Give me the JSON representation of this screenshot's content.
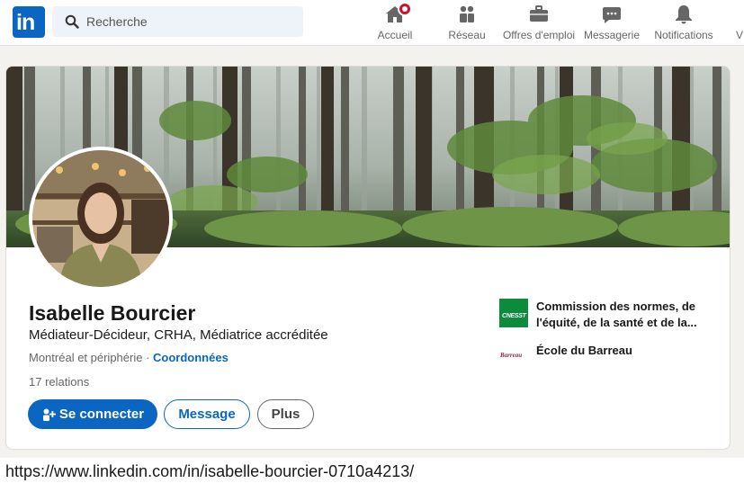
{
  "nav": {
    "search_placeholder": "Recherche",
    "items": [
      {
        "label": "Accueil",
        "icon": "home-icon"
      },
      {
        "label": "Réseau",
        "icon": "network-icon"
      },
      {
        "label": "Offres d'emploi",
        "icon": "briefcase-icon"
      },
      {
        "label": "Messagerie",
        "icon": "messaging-icon"
      },
      {
        "label": "Notifications",
        "icon": "bell-icon"
      },
      {
        "label": "V",
        "icon": "me-icon"
      }
    ],
    "brand_color": "#0a66c2"
  },
  "profile": {
    "name": "Isabelle Bourcier",
    "headline": "Médiateur-Décideur, CRHA, Médiatrice accréditée",
    "location": "Montréal et périphérie",
    "separator": " · ",
    "contact_link": "Coordonnées",
    "relations": "17 relations"
  },
  "actions": {
    "connect": "Se connecter",
    "message": "Message",
    "more": "Plus"
  },
  "experience": [
    {
      "logo_text": "CNESST",
      "label": "Commission des normes, de l'équité, de la santé et de la..."
    },
    {
      "logo_text": "Barreau",
      "label": "École du Barreau"
    }
  ],
  "url": "https://www.linkedin.com/in/isabelle-bourcier-0710a4213/"
}
